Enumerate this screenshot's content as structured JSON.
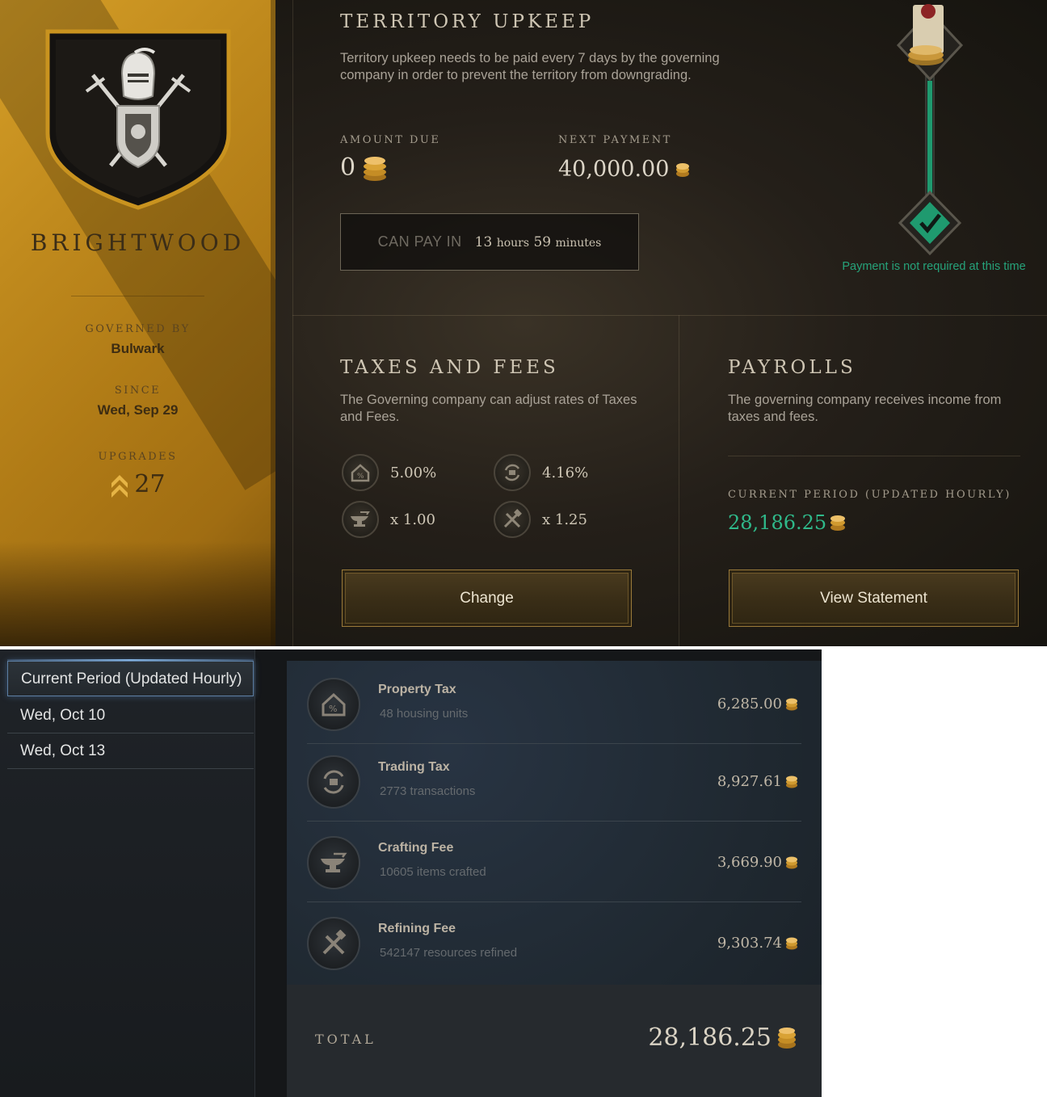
{
  "territory": {
    "name": "BRIGHTWOOD",
    "governed_by_label": "GOVERNED BY",
    "governed_by": "Bulwark",
    "since_label": "SINCE",
    "since": "Wed, Sep 29",
    "upgrades_label": "UPGRADES",
    "upgrades": "27"
  },
  "upkeep": {
    "title": "TERRITORY UPKEEP",
    "description": "Territory upkeep needs to be paid every 7 days by the governing company in order to prevent the territory from downgrading.",
    "amount_due_label": "AMOUNT DUE",
    "amount_due": "0",
    "next_payment_label": "NEXT PAYMENT",
    "next_payment": "40,000.00",
    "can_pay_label": "CAN PAY IN",
    "hours": "13",
    "hours_unit": "hours",
    "minutes": "59",
    "minutes_unit": "minutes",
    "status_note": "Payment is not required at this time"
  },
  "taxes": {
    "title": "TAXES AND FEES",
    "description": "The Governing company can adjust rates of Taxes and Fees.",
    "property_tax": "5.00%",
    "trading_tax": "4.16%",
    "crafting_fee": "x 1.00",
    "refining_fee": "x 1.25",
    "button": "Change"
  },
  "payrolls": {
    "title": "PAYROLLS",
    "description": "The governing company receives income from taxes and fees.",
    "current_label": "CURRENT PERIOD (UPDATED HOURLY)",
    "current_value": "28,186.25",
    "button": "View Statement"
  },
  "periods": [
    {
      "label": "Current Period (Updated Hourly)"
    },
    {
      "label": "Wed, Oct 10"
    },
    {
      "label": "Wed, Oct 13"
    }
  ],
  "statement": {
    "rows": [
      {
        "name": "Property Tax",
        "sub": "48 housing units",
        "amount": "6,285.00",
        "icon": "house-icon"
      },
      {
        "name": "Trading Tax",
        "sub": "2773 transactions",
        "amount": "8,927.61",
        "icon": "trade-cycle-icon"
      },
      {
        "name": "Crafting Fee",
        "sub": "10605 items crafted",
        "amount": "3,669.90",
        "icon": "anvil-icon"
      },
      {
        "name": "Refining Fee",
        "sub": "542147 resources refined",
        "amount": "9,303.74",
        "icon": "tools-icon"
      }
    ],
    "total_label": "TOTAL",
    "total": "28,186.25"
  },
  "colors": {
    "gold_panel": "#c08a1d",
    "accent_green": "#2fb98a",
    "active_blue": "#5d7fa3"
  }
}
